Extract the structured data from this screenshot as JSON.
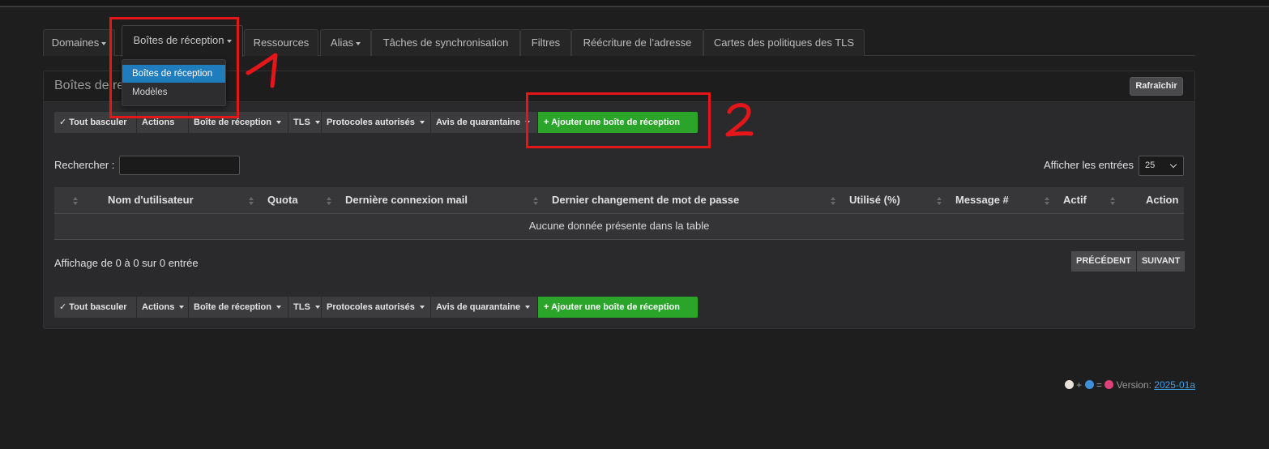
{
  "tabs": [
    {
      "label": "Domaines",
      "caret": true
    },
    {
      "label": "Boîtes de réception",
      "caret": true,
      "active": true
    },
    {
      "label": "Ressources",
      "caret": false
    },
    {
      "label": "Alias",
      "caret": true
    },
    {
      "label": "Tâches de synchronisation",
      "caret": false
    },
    {
      "label": "Filtres",
      "caret": false
    },
    {
      "label": "Réécriture de l’adresse",
      "caret": false
    },
    {
      "label": "Cartes des politiques des TLS",
      "caret": false
    }
  ],
  "dropdown": {
    "items": [
      {
        "label": "Boîtes de réception",
        "selected": true
      },
      {
        "label": "Modèles",
        "selected": false
      }
    ]
  },
  "panel": {
    "title": "Boîtes de re",
    "refresh_label": "Rafraîchir"
  },
  "toolbar": {
    "toggle_all": "Tout basculer",
    "actions": "Actions",
    "mailbox": "Boîte de réception",
    "tls": "TLS",
    "protocols": "Protocoles autorisés",
    "quarantine": "Avis de quarantaine",
    "add_mailbox": "Ajouter une boîte de réception",
    "top_actions_fragment": "Actions",
    "top_mailbox_fragment": "Boîte de réception"
  },
  "search": {
    "label": "Rechercher :",
    "value": ""
  },
  "show_entries": {
    "label": "Afficher les entrées",
    "value": "25"
  },
  "table": {
    "columns": [
      "Nom d'utilisateur",
      "Quota",
      "Dernière connexion mail",
      "Dernier changement de mot de passe",
      "Utilisé (%)",
      "Message #",
      "Actif",
      "Action"
    ],
    "empty_text": "Aucune donnée présente dans la table"
  },
  "info_text": "Affichage de 0 à 0 sur 0 entrée",
  "pager": {
    "prev": "PRÉCÉDENT",
    "next": "SUIVANT"
  },
  "annotations": [
    "1",
    "2"
  ],
  "footer": {
    "version_label": "Version:",
    "version": "2025-01a",
    "plus": "+",
    "equals": "="
  },
  "colors": {
    "accent_blue": "#1f7dbd",
    "add_green": "#2aa52a",
    "annotation_red": "#e4161a"
  }
}
